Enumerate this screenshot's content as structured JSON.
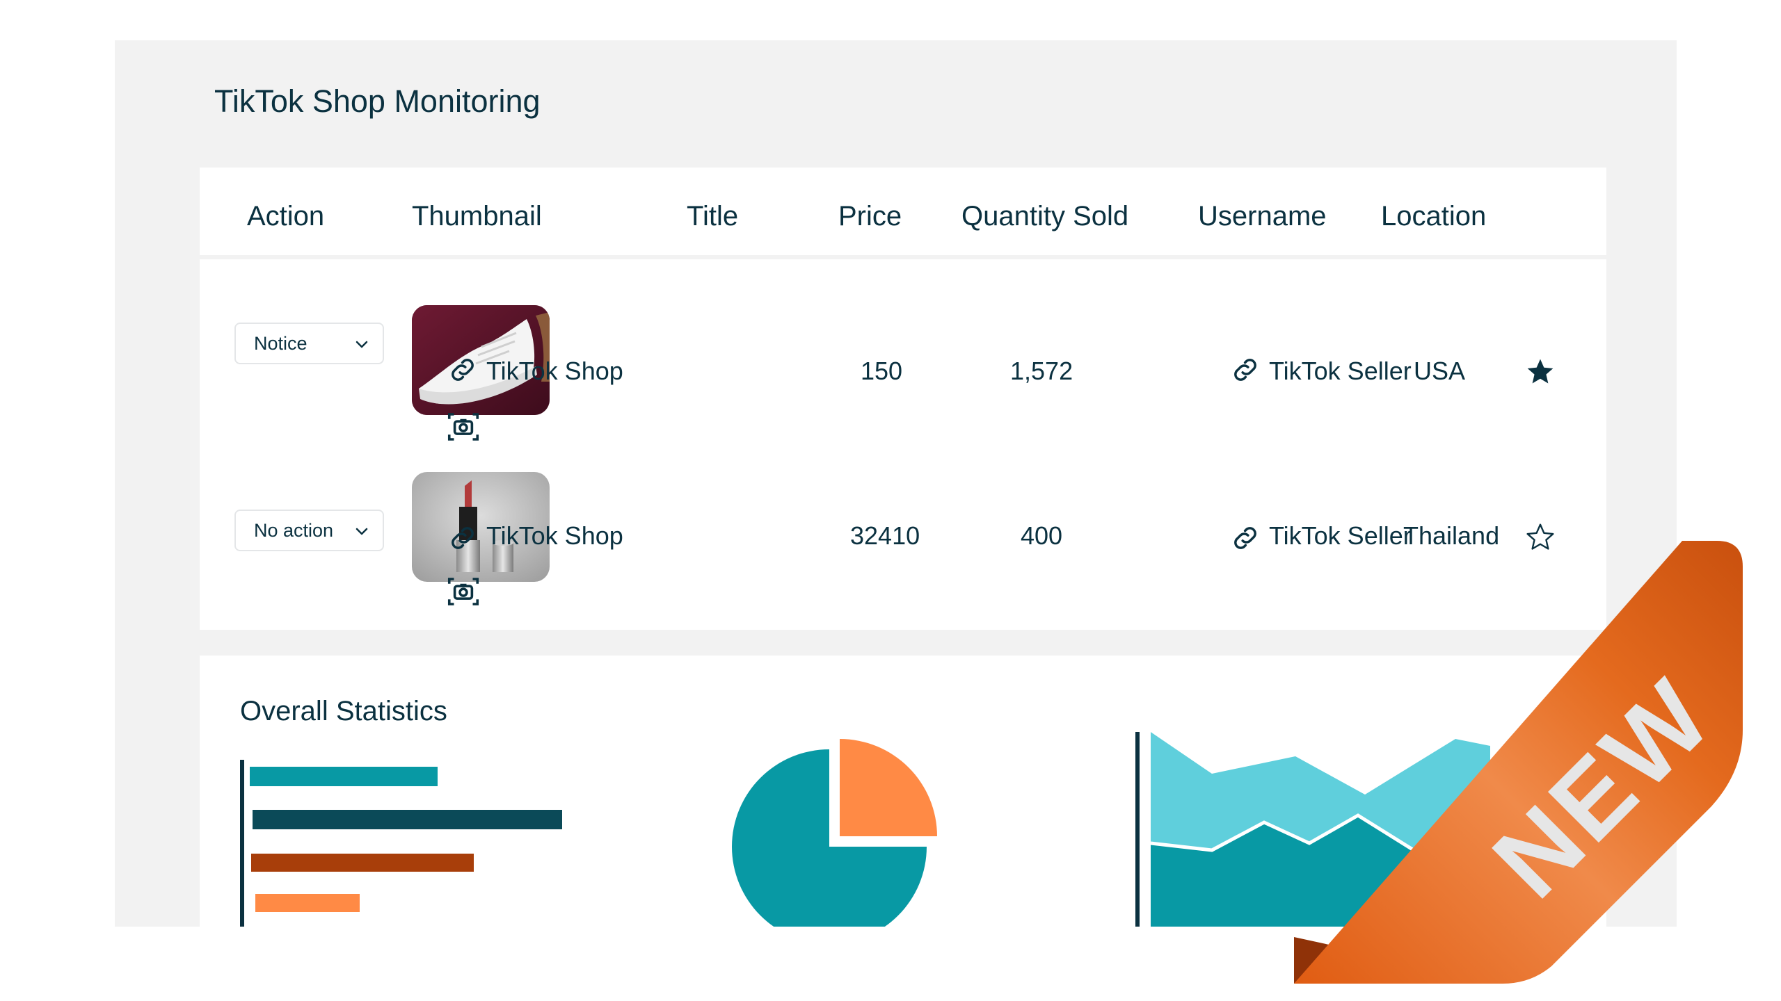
{
  "page_title": "TikTok Shop Monitoring",
  "table": {
    "headers": [
      "Action",
      "Thumbnail",
      "Title",
      "Price",
      "Quantity Sold",
      "Username",
      "Location"
    ],
    "rows": [
      {
        "action": "Notice",
        "thumbnail": "white-sneaker",
        "title": "TikTok Shop",
        "price": "150",
        "quantity_sold": "1,572",
        "username": "TikTok Seller",
        "location": "USA",
        "starred": true
      },
      {
        "action": "No action",
        "thumbnail": "red-lipstick",
        "title": "TikTok Shop",
        "price": "32410",
        "quantity_sold": "400",
        "username": "TikTok Seller",
        "location": "Thailand",
        "starred": false
      }
    ]
  },
  "stats": {
    "title": "Overall Statistics"
  },
  "badge": {
    "label": "NEW"
  },
  "colors": {
    "text": "#0b3140",
    "teal": "#0899a4",
    "teal_light": "#5fcfdc",
    "navy": "#0b4a58",
    "rust": "#a83e0a",
    "orange": "#ff8a45",
    "ribbon": "#e0651a"
  },
  "icons": {
    "title_link": "link-icon",
    "screenshot": "camera-capture-icon",
    "username_link": "link-icon",
    "favorite": "star-icon",
    "dropdown": "chevron-down-icon"
  }
}
